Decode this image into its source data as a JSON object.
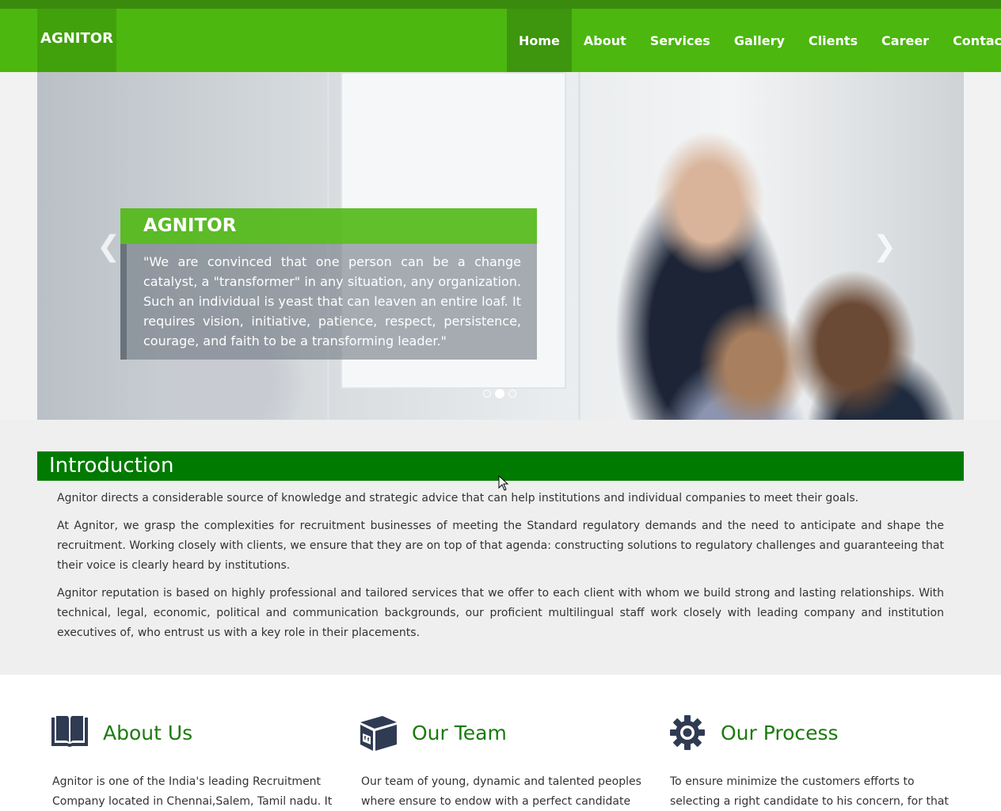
{
  "header": {
    "brand": "AGNITOR",
    "nav": [
      "Home",
      "About",
      "Services",
      "Gallery",
      "Clients",
      "Career",
      "Contact"
    ],
    "active_index": 0
  },
  "hero": {
    "caption_title": "AGNITOR",
    "caption_text": "\"We are convinced that one person can be a change catalyst, a \"transformer\" in any situation, any organization. Such an individual is yeast that can leaven an entire loaf. It requires vision, initiative, patience, respect, persistence, courage, and faith to be a transforming leader.\"",
    "prev_icon": "chevron-left-icon",
    "next_icon": "chevron-right-icon",
    "slide_count": 3,
    "active_slide": 1
  },
  "intro": {
    "title": "Introduction",
    "paragraphs": [
      "Agnitor directs a considerable source of knowledge and strategic advice that can help institutions and individual companies to meet their goals.",
      "At Agnitor, we grasp the complexities for recruitment businesses of meeting the Standard regulatory demands and the need to anticipate and shape the recruitment. Working closely with clients, we ensure that they are on top of that agenda: constructing solutions to regulatory challenges and guaranteeing that their voice is clearly heard by institutions.",
      "Agnitor reputation is based on highly professional and tailored services that we offer to each client with whom we build strong and lasting relationships. With technical, legal, economic, political and communication backgrounds, our proficient multilingual staff work closely with leading company and institution executives of, who entrust us with a key role in their placements."
    ]
  },
  "features": [
    {
      "icon": "book-icon",
      "title": "About Us",
      "text": "Agnitor is one of the India's leading Recruitment Company located in Chennai,Salem, Tamil nadu. It was"
    },
    {
      "icon": "box-icon",
      "title": "Our Team",
      "text": "Our team of young, dynamic and talented peoples where ensure to endow with a perfect candidate to your"
    },
    {
      "icon": "gear-icon",
      "title": "Our Process",
      "text": "To ensure minimize the customers efforts to selecting a right candidate to his concern, for that we screening the"
    }
  ],
  "colors": {
    "nav_green": "#4cb70f",
    "heading_green": "#007a00",
    "title_green": "#1b7a0d",
    "icon_navy": "#2f3b52"
  }
}
